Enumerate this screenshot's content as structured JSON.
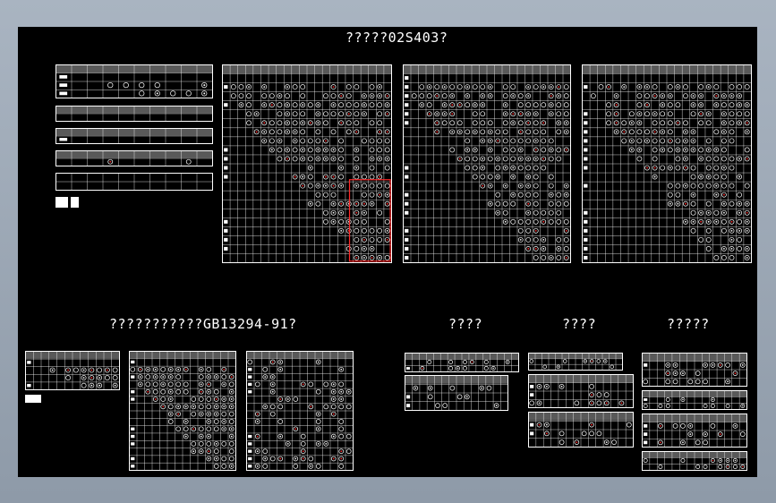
{
  "titles": {
    "top": "?????02S403?",
    "bottom_left": "???????????GB13294-91?",
    "bottom_mid1": "????",
    "bottom_mid2": "????",
    "bottom_right": "?????"
  },
  "colors": {
    "background": "#000000",
    "line": "#ffffff",
    "highlight": "#ff2a2a",
    "frame": "#9aa6b4"
  }
}
